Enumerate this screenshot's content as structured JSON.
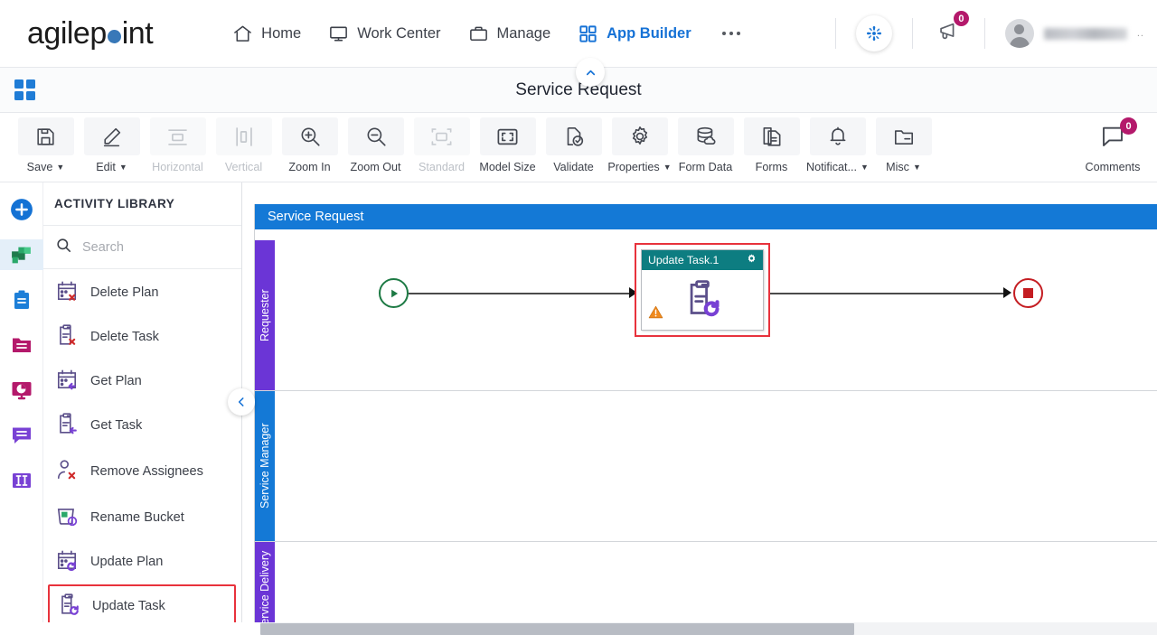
{
  "header": {
    "logo_text_1": "agilep",
    "logo_text_2": "int",
    "nav": [
      {
        "label": "Home",
        "icon": "home-icon",
        "active": false
      },
      {
        "label": "Work Center",
        "icon": "monitor-icon",
        "active": false
      },
      {
        "label": "Manage",
        "icon": "briefcase-icon",
        "active": false
      },
      {
        "label": "App Builder",
        "icon": "grid-icon",
        "active": true
      }
    ],
    "more_label": "more-options",
    "swirl_icon": "swirl-icon",
    "announcement_icon": "megaphone-icon",
    "announcement_count": "0",
    "avatar_icon": "avatar",
    "user_name": "",
    "user_menu_dots": ".."
  },
  "sub_header": {
    "apps_icon": "apps-grid-icon",
    "title": "Service Request",
    "collapse_icon": "chevron-up-icon"
  },
  "toolbar": {
    "items": [
      {
        "label": "Save",
        "icon": "save-icon",
        "caret": true,
        "disabled": false
      },
      {
        "label": "Edit",
        "icon": "pencil-icon",
        "caret": true,
        "disabled": false
      },
      {
        "label": "Horizontal",
        "icon": "horizontal-icon",
        "caret": false,
        "disabled": true
      },
      {
        "label": "Vertical",
        "icon": "vertical-icon",
        "caret": false,
        "disabled": true
      },
      {
        "label": "Zoom In",
        "icon": "zoom-in-icon",
        "caret": false,
        "disabled": false
      },
      {
        "label": "Zoom Out",
        "icon": "zoom-out-icon",
        "caret": false,
        "disabled": false
      },
      {
        "label": "Standard",
        "icon": "standard-icon",
        "caret": false,
        "disabled": true
      },
      {
        "label": "Model Size",
        "icon": "model-size-icon",
        "caret": false,
        "disabled": false
      },
      {
        "label": "Validate",
        "icon": "validate-icon",
        "caret": false,
        "disabled": false
      },
      {
        "label": "Properties",
        "icon": "gear-icon",
        "caret": true,
        "disabled": false
      },
      {
        "label": "Form Data",
        "icon": "database-icon",
        "caret": false,
        "disabled": false
      },
      {
        "label": "Forms",
        "icon": "document-icon",
        "caret": false,
        "disabled": false
      },
      {
        "label": "Notificat...",
        "icon": "bell-icon",
        "caret": true,
        "disabled": false
      },
      {
        "label": "Misc",
        "icon": "folder-icon",
        "caret": true,
        "disabled": false
      }
    ],
    "comments": {
      "label": "Comments",
      "icon": "comment-icon",
      "count": "0"
    }
  },
  "icon_rail": [
    {
      "name": "add-icon",
      "selected": false,
      "color": "#1472d4"
    },
    {
      "name": "activities-icon",
      "selected": true,
      "color": "#2aa86a"
    },
    {
      "name": "clipboard-icon",
      "selected": false,
      "color": "#1d7fd8"
    },
    {
      "name": "folder-icon",
      "selected": false,
      "color": "#b4196b"
    },
    {
      "name": "reports-icon",
      "selected": false,
      "color": "#b4196b"
    },
    {
      "name": "comments-icon",
      "selected": false,
      "color": "#7841d4"
    },
    {
      "name": "columns-icon",
      "selected": false,
      "color": "#7841d4"
    }
  ],
  "activity_library": {
    "title": "ACTIVITY LIBRARY",
    "search": {
      "placeholder": "Search",
      "value": "",
      "icon": "search-icon"
    },
    "items": [
      {
        "label": "Delete Plan",
        "icon": "calendar-delete-icon",
        "highlight": false
      },
      {
        "label": "Delete Task",
        "icon": "clipboard-delete-icon",
        "highlight": false
      },
      {
        "label": "Get Plan",
        "icon": "calendar-get-icon",
        "highlight": false
      },
      {
        "label": "Get Task",
        "icon": "clipboard-get-icon",
        "highlight": false
      },
      {
        "label": "Remove Assignees",
        "icon": "person-remove-icon",
        "highlight": false
      },
      {
        "label": "Rename Bucket",
        "icon": "bucket-rename-icon",
        "highlight": false
      },
      {
        "label": "Update Plan",
        "icon": "calendar-update-icon",
        "highlight": false
      },
      {
        "label": "Update Task",
        "icon": "clipboard-update-icon",
        "highlight": true
      }
    ],
    "collapse_icon": "chevron-left-icon"
  },
  "canvas": {
    "pool_title": "Service Request",
    "lanes": [
      {
        "label": "Requester",
        "color": "#6b35d6"
      },
      {
        "label": "Service Manager",
        "color": "#1479d6"
      },
      {
        "label": "Service Delivery",
        "color": "#6b35d6"
      }
    ],
    "start_event": {
      "name": "start-event",
      "icon": "play-icon"
    },
    "end_event": {
      "name": "end-event",
      "icon": "stop-icon"
    },
    "task": {
      "title": "Update Task.1",
      "settings_icon": "gear-icon",
      "body_icon": "clipboard-update-icon",
      "warning_icon": "warning-icon",
      "header_color": "#0d7d81",
      "selection_color": "#e8323c"
    }
  },
  "colors": {
    "accent_blue": "#1672d6",
    "brand_blue": "#3878b8",
    "badge_magenta": "#b4196b",
    "highlight_red": "#e8323c",
    "teal": "#0d7d81"
  }
}
